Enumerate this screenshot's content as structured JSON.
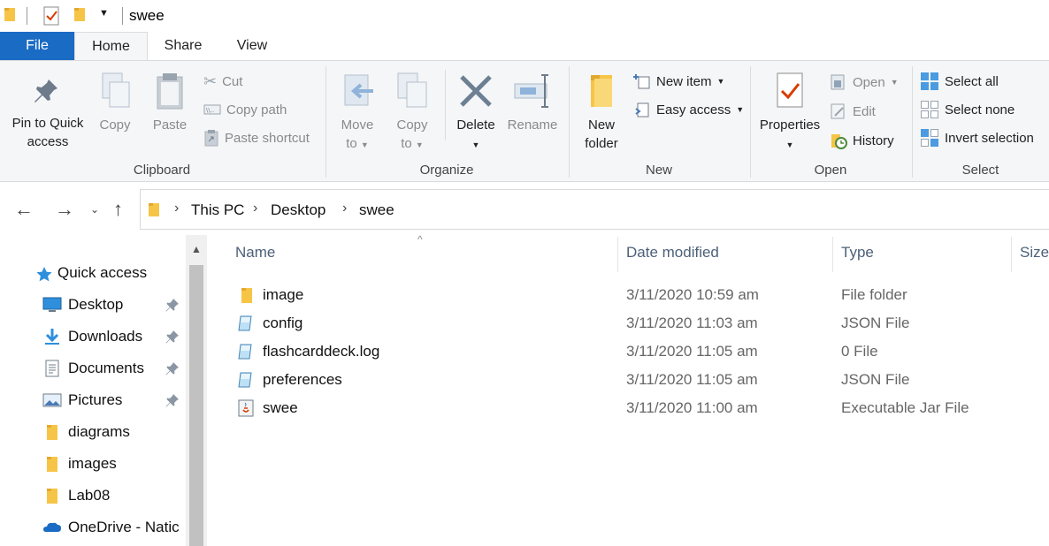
{
  "window": {
    "title": "swee"
  },
  "tabs": [
    "File",
    "Home",
    "Share",
    "View"
  ],
  "ribbon": {
    "clipboard": {
      "label": "Clipboard",
      "pin_line1": "Pin to Quick",
      "pin_line2": "access",
      "copy": "Copy",
      "paste": "Paste",
      "cut": "Cut",
      "copy_path": "Copy path",
      "paste_shortcut": "Paste shortcut"
    },
    "organize": {
      "label": "Organize",
      "move_line1": "Move",
      "move_line2": "to",
      "copyto_line1": "Copy",
      "copyto_line2": "to",
      "delete": "Delete",
      "rename": "Rename"
    },
    "new": {
      "label": "New",
      "folder_line1": "New",
      "folder_line2": "folder",
      "new_item": "New item",
      "easy_access": "Easy access"
    },
    "open": {
      "label": "Open",
      "properties": "Properties",
      "open": "Open",
      "edit": "Edit",
      "history": "History"
    },
    "select": {
      "label": "Select",
      "select_all": "Select all",
      "select_none": "Select none",
      "invert": "Invert selection"
    }
  },
  "breadcrumb": [
    "This PC",
    "Desktop",
    "swee"
  ],
  "nav": {
    "quick_access": "Quick access",
    "items": [
      {
        "label": "Desktop",
        "icon": "desktop-icon",
        "pinned": true
      },
      {
        "label": "Downloads",
        "icon": "download-icon",
        "pinned": true
      },
      {
        "label": "Documents",
        "icon": "documents-icon",
        "pinned": true
      },
      {
        "label": "Pictures",
        "icon": "pictures-icon",
        "pinned": true
      },
      {
        "label": "diagrams",
        "icon": "folder-icon",
        "pinned": false
      },
      {
        "label": "images",
        "icon": "folder-icon",
        "pinned": false
      },
      {
        "label": "Lab08",
        "icon": "folder-icon",
        "pinned": false
      },
      {
        "label": "OneDrive - Natic",
        "icon": "onedrive-icon",
        "pinned": false
      }
    ]
  },
  "columns": {
    "name": "Name",
    "date": "Date modified",
    "type": "Type",
    "size": "Size"
  },
  "files": [
    {
      "name": "image",
      "date": "3/11/2020 10:59 am",
      "type": "File folder",
      "icon": "folder-icon"
    },
    {
      "name": "config",
      "date": "3/11/2020 11:03 am",
      "type": "JSON File",
      "icon": "file-icon"
    },
    {
      "name": "flashcarddeck.log",
      "date": "3/11/2020 11:05 am",
      "type": "0 File",
      "icon": "file-icon"
    },
    {
      "name": "preferences",
      "date": "3/11/2020 11:05 am",
      "type": "JSON File",
      "icon": "file-icon"
    },
    {
      "name": "swee",
      "date": "3/11/2020 11:00 am",
      "type": "Executable Jar File",
      "icon": "jar-icon"
    }
  ],
  "colors": {
    "accent": "#1a6bc4",
    "ribbon_bg": "#f5f6f7",
    "folder": "#f6c548"
  }
}
